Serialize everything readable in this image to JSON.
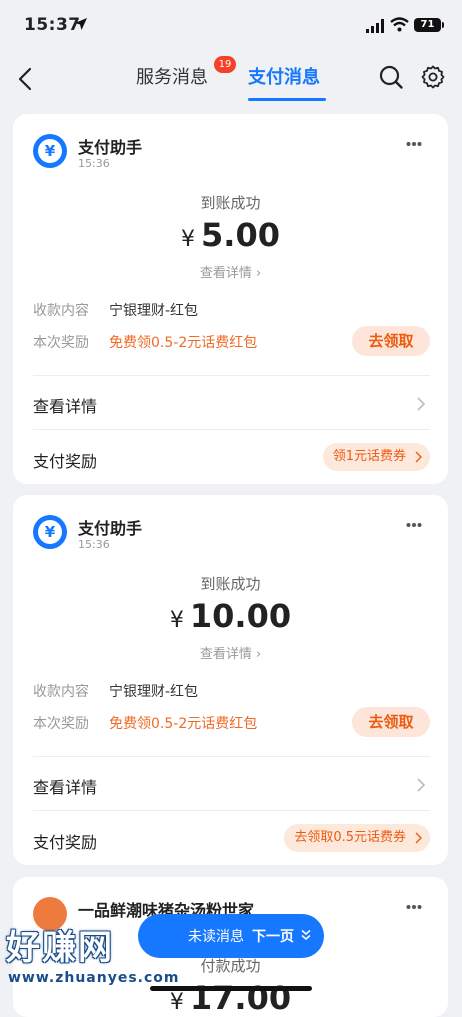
{
  "status_bar": {
    "time": "15:37",
    "battery": "71"
  },
  "nav": {
    "tabs": [
      {
        "label": "服务消息",
        "badge": "19"
      },
      {
        "label": "支付消息"
      }
    ],
    "accent_color": "#1677ff"
  },
  "cards": [
    {
      "sender": "支付助手",
      "time": "15:36",
      "status": "到账成功",
      "currency": "¥",
      "amount": "5.00",
      "detail_link": "查看详情",
      "content_label": "收款内容",
      "content_value": "宁银理财-红包",
      "reward_label": "本次奖励",
      "reward_value": "免费领0.5-2元话费红包",
      "claim_button": "去领取",
      "row_details": "查看详情",
      "row_reward": "支付奖励",
      "coupon": "领1元话费券"
    },
    {
      "sender": "支付助手",
      "time": "15:36",
      "status": "到账成功",
      "currency": "¥",
      "amount": "10.00",
      "detail_link": "查看详情",
      "content_label": "收款内容",
      "content_value": "宁银理财-红包",
      "reward_label": "本次奖励",
      "reward_value": "免费领0.5-2元话费红包",
      "claim_button": "去领取",
      "row_details": "查看详情",
      "row_reward": "支付奖励",
      "coupon": "去领取0.5元话费券"
    },
    {
      "sender": "一品鲜潮味猪杂汤粉世家",
      "status": "付款成功",
      "currency": "¥",
      "amount": "17.00"
    }
  ],
  "float_button": {
    "unread": "未读消息",
    "next": "下一页"
  },
  "watermark": {
    "big": "好赚网",
    "small": "www.zhuanyes.com"
  }
}
